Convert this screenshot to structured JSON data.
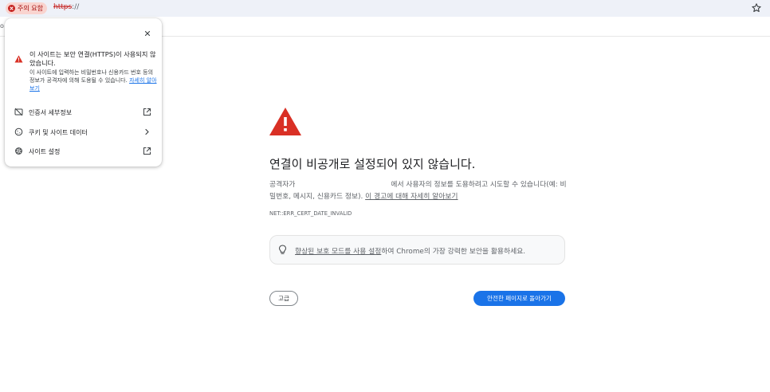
{
  "address_bar": {
    "chip_label": "주의 요함",
    "url_scheme": "https",
    "url_rest": "://",
    "status_color": "#c5221f",
    "bookmark_icon": "star-icon"
  },
  "left_edge_char": "o",
  "popup": {
    "title": "이 사이트는 보안 연결(HTTPS)이 사용되지 않았습니다.",
    "body": "이 사이트에 입력하는 비밀번호나 신용카드 번호 등의 정보가 공격자에 의해 도용될 수 있습니다.",
    "learn_more": "자세히 알아보기",
    "items": [
      {
        "label": "인증서 세부정보",
        "icon": "certificate-icon",
        "trailing": "external-link-icon"
      },
      {
        "label": "쿠키 및 사이트 데이터",
        "icon": "cookie-icon",
        "trailing": "chevron-right-icon"
      },
      {
        "label": "사이트 설정",
        "icon": "gear-icon",
        "trailing": "external-link-icon"
      }
    ]
  },
  "interstitial": {
    "heading": "연결이 비공개로 설정되어 있지 않습니다.",
    "body_prefix": "공격자가",
    "body_middle": "에서 사용자의 정보를 도용하려고 시도할 수 있습니다(예: 비밀번호, 메시지, 신용카드 정보).",
    "body_link": "이 경고에 대해 자세히 알아보기",
    "error_code": "NET::ERR_CERT_DATE_INVALID",
    "promo_link": "향상된 보호 모드를 사용 설정",
    "promo_rest": "하여 Chrome의 가장 강력한 보안을 활용하세요.",
    "advanced_button": "고급",
    "back_button": "안전한 페이지로 돌아가기",
    "accent_color": "#1a73e8",
    "warning_color": "#d93025"
  }
}
